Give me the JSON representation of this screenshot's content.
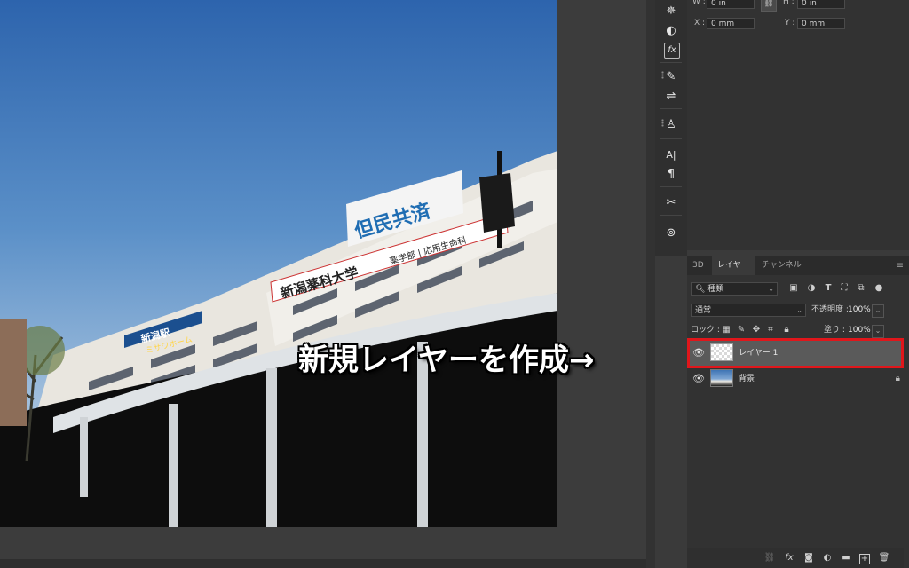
{
  "annotation": {
    "text": "新規レイヤーを作成→"
  },
  "photo": {
    "signs": {
      "top_sign": "但民共済",
      "university_sign": "新潟薬科大学",
      "university_sub": "薬学部 | 応用生命科",
      "station_sign": "新潟駅",
      "home_sign": "ミサワホーム"
    }
  },
  "tools": [
    {
      "icon": "compass-icon",
      "glyph": "✵"
    },
    {
      "icon": "half-circle-icon",
      "glyph": "◐"
    },
    {
      "icon": "fx-icon",
      "glyph": "fx"
    },
    {
      "icon": "brush-icon",
      "glyph": "✎"
    },
    {
      "icon": "sliders-icon",
      "glyph": "⇌"
    },
    {
      "icon": "stamp-icon",
      "glyph": "♙"
    },
    {
      "icon": "type-icon",
      "glyph": "A|"
    },
    {
      "icon": "paragraph-icon",
      "glyph": "¶"
    },
    {
      "icon": "scissors-tools-icon",
      "glyph": "✂"
    },
    {
      "icon": "cc-libraries-icon",
      "glyph": "⊚"
    }
  ],
  "properties": {
    "w_label": "W :",
    "w_value": "0 in",
    "h_label": "H :",
    "h_value": "0 in",
    "x_label": "X :",
    "x_value": "0 mm",
    "y_label": "Y :",
    "y_value": "0 mm"
  },
  "layers_panel": {
    "tabs": [
      {
        "label": "3D",
        "active": false
      },
      {
        "label": "レイヤー",
        "active": true
      },
      {
        "label": "チャンネル",
        "active": false
      }
    ],
    "filter": {
      "value": "種類"
    },
    "blend_mode": {
      "value": "通常"
    },
    "opacity": {
      "label": "不透明度 :",
      "value": "100%"
    },
    "lock": {
      "label": "ロック :"
    },
    "fill": {
      "label": "塗り :",
      "value": "100%"
    },
    "layers": [
      {
        "name": "レイヤー 1",
        "selected": true,
        "locked": false
      },
      {
        "name": "背景",
        "selected": false,
        "locked": true
      }
    ]
  },
  "colors": {
    "highlight": "#e0161b",
    "panel_bg": "#323232",
    "selected_layer_bg": "#5a5a5a"
  }
}
